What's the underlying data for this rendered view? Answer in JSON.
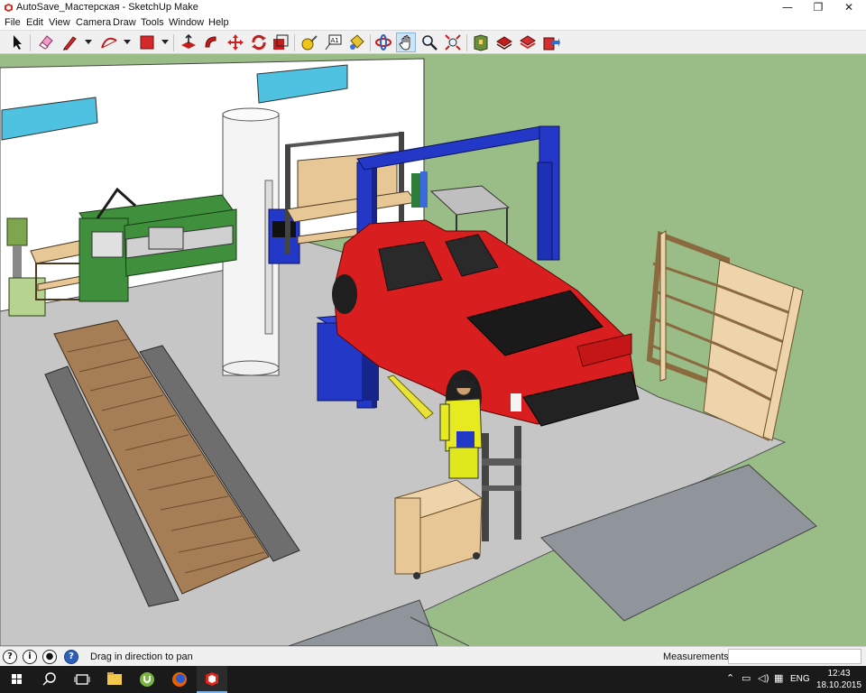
{
  "window": {
    "title": "AutoSave_Мастерская - SketchUp Make",
    "controls": {
      "minimize": "—",
      "maximize": "❐",
      "close": "✕"
    }
  },
  "menu": {
    "items": [
      {
        "label": "File"
      },
      {
        "label": "Edit"
      },
      {
        "label": "View"
      },
      {
        "label": "Camera"
      },
      {
        "label": "Draw"
      },
      {
        "label": "Tools"
      },
      {
        "label": "Window"
      },
      {
        "label": "Help"
      }
    ]
  },
  "toolbar": {
    "tools": [
      "select",
      "eraser",
      "pencil-line",
      "arc",
      "push-pull",
      "follow-me",
      "move",
      "rotate",
      "offset",
      "tape-measure",
      "text",
      "paint-bucket",
      "orbit",
      "pan",
      "zoom",
      "zoom-extents",
      "3d-warehouse",
      "extension-warehouse",
      "layout",
      "send-to-layout"
    ],
    "active_tool": "pan"
  },
  "status": {
    "hint": "Drag in direction to pan",
    "measurements_label": "Measurements",
    "measurements_value": "",
    "icons": [
      "georeference-icon",
      "credits-icon",
      "user-icon",
      "help-icon"
    ]
  },
  "taskbar": {
    "apps": [
      "start",
      "search",
      "task-view",
      "file-explorer",
      "utorrent",
      "firefox",
      "sketchup"
    ],
    "tray": {
      "language": "ENG",
      "time": "12:43",
      "date": "18.10.2015"
    }
  },
  "colors": {
    "grass": "#9abd87",
    "floor": "#c5c5c5",
    "wall": "#ffffff",
    "truck": "#d81e1e",
    "lift": "#2438c8",
    "wood": "#e8c797"
  }
}
